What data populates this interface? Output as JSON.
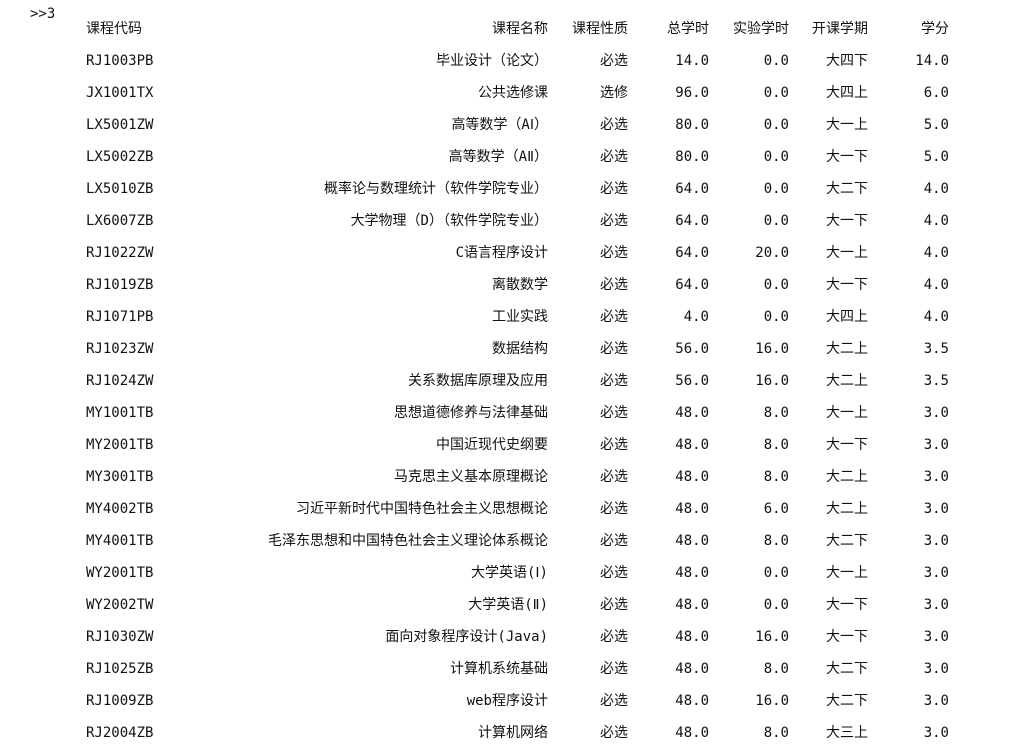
{
  "console": {
    "prompt": ">>3"
  },
  "table": {
    "headers": {
      "code": "课程代码",
      "name": "课程名称",
      "type": "课程性质",
      "hours": "总学时",
      "lab": "实验学时",
      "term": "开课学期",
      "credit": "学分"
    },
    "rows": [
      {
        "code": "RJ1003PB",
        "name": "毕业设计（论文）",
        "type": "必选",
        "hours": "14.0",
        "lab": "0.0",
        "term": "大四下",
        "credit": "14.0"
      },
      {
        "code": "JX1001TX",
        "name": "公共选修课",
        "type": "选修",
        "hours": "96.0",
        "lab": "0.0",
        "term": "大四上",
        "credit": "6.0"
      },
      {
        "code": "LX5001ZW",
        "name": "高等数学（AⅠ）",
        "type": "必选",
        "hours": "80.0",
        "lab": "0.0",
        "term": "大一上",
        "credit": "5.0"
      },
      {
        "code": "LX5002ZB",
        "name": "高等数学（AⅡ）",
        "type": "必选",
        "hours": "80.0",
        "lab": "0.0",
        "term": "大一下",
        "credit": "5.0"
      },
      {
        "code": "LX5010ZB",
        "name": "概率论与数理统计（软件学院专业）",
        "type": "必选",
        "hours": "64.0",
        "lab": "0.0",
        "term": "大二下",
        "credit": "4.0"
      },
      {
        "code": "LX6007ZB",
        "name": "大学物理（D）（软件学院专业）",
        "type": "必选",
        "hours": "64.0",
        "lab": "0.0",
        "term": "大一下",
        "credit": "4.0"
      },
      {
        "code": "RJ1022ZW",
        "name": "C语言程序设计",
        "type": "必选",
        "hours": "64.0",
        "lab": "20.0",
        "term": "大一上",
        "credit": "4.0"
      },
      {
        "code": "RJ1019ZB",
        "name": "离散数学",
        "type": "必选",
        "hours": "64.0",
        "lab": "0.0",
        "term": "大一下",
        "credit": "4.0"
      },
      {
        "code": "RJ1071PB",
        "name": "工业实践",
        "type": "必选",
        "hours": "4.0",
        "lab": "0.0",
        "term": "大四上",
        "credit": "4.0"
      },
      {
        "code": "RJ1023ZW",
        "name": "数据结构",
        "type": "必选",
        "hours": "56.0",
        "lab": "16.0",
        "term": "大二上",
        "credit": "3.5"
      },
      {
        "code": "RJ1024ZW",
        "name": "关系数据库原理及应用",
        "type": "必选",
        "hours": "56.0",
        "lab": "16.0",
        "term": "大二上",
        "credit": "3.5"
      },
      {
        "code": "MY1001TB",
        "name": "思想道德修养与法律基础",
        "type": "必选",
        "hours": "48.0",
        "lab": "8.0",
        "term": "大一上",
        "credit": "3.0"
      },
      {
        "code": "MY2001TB",
        "name": "中国近现代史纲要",
        "type": "必选",
        "hours": "48.0",
        "lab": "8.0",
        "term": "大一下",
        "credit": "3.0"
      },
      {
        "code": "MY3001TB",
        "name": "马克思主义基本原理概论",
        "type": "必选",
        "hours": "48.0",
        "lab": "8.0",
        "term": "大二上",
        "credit": "3.0"
      },
      {
        "code": "MY4002TB",
        "name": "习近平新时代中国特色社会主义思想概论",
        "type": "必选",
        "hours": "48.0",
        "lab": "6.0",
        "term": "大二上",
        "credit": "3.0"
      },
      {
        "code": "MY4001TB",
        "name": "毛泽东思想和中国特色社会主义理论体系概论",
        "type": "必选",
        "hours": "48.0",
        "lab": "8.0",
        "term": "大二下",
        "credit": "3.0"
      },
      {
        "code": "WY2001TB",
        "name": "大学英语(Ⅰ)",
        "type": "必选",
        "hours": "48.0",
        "lab": "0.0",
        "term": "大一上",
        "credit": "3.0"
      },
      {
        "code": "WY2002TW",
        "name": "大学英语(Ⅱ)",
        "type": "必选",
        "hours": "48.0",
        "lab": "0.0",
        "term": "大一下",
        "credit": "3.0"
      },
      {
        "code": "RJ1030ZW",
        "name": "面向对象程序设计(Java)",
        "type": "必选",
        "hours": "48.0",
        "lab": "16.0",
        "term": "大一下",
        "credit": "3.0"
      },
      {
        "code": "RJ1025ZB",
        "name": "计算机系统基础",
        "type": "必选",
        "hours": "48.0",
        "lab": "8.0",
        "term": "大二下",
        "credit": "3.0"
      },
      {
        "code": "RJ1009ZB",
        "name": "web程序设计",
        "type": "必选",
        "hours": "48.0",
        "lab": "16.0",
        "term": "大二下",
        "credit": "3.0"
      },
      {
        "code": "RJ2004ZB",
        "name": "计算机网络",
        "type": "必选",
        "hours": "48.0",
        "lab": "8.0",
        "term": "大三上",
        "credit": "3.0"
      }
    ]
  }
}
